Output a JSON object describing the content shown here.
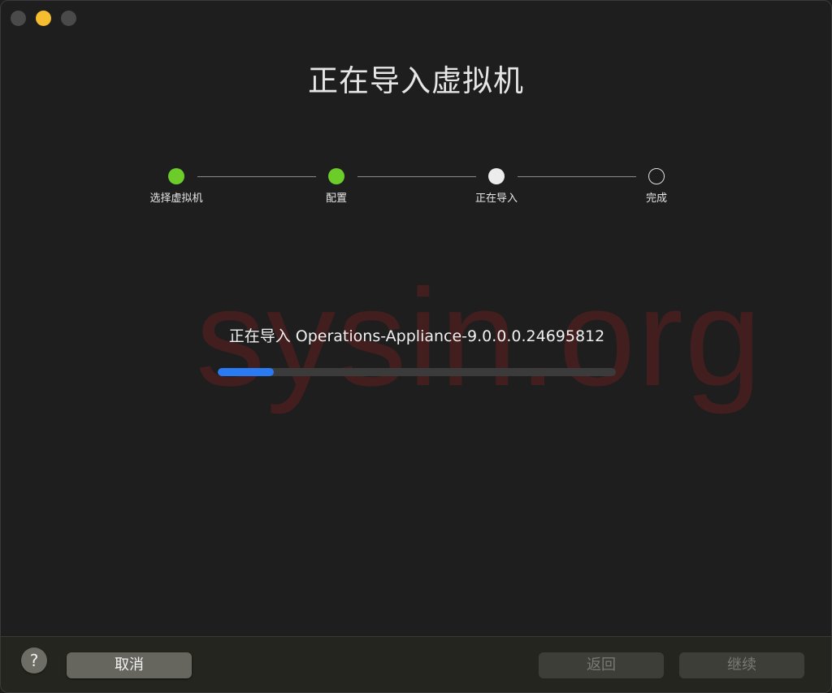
{
  "window": {
    "title": "正在导入虚拟机"
  },
  "steps": [
    {
      "label": "选择虚拟机",
      "status": "done"
    },
    {
      "label": "配置",
      "status": "done"
    },
    {
      "label": "正在导入",
      "status": "current"
    },
    {
      "label": "完成",
      "status": "todo"
    }
  ],
  "import": {
    "label": "正在导入 Operations-Appliance-9.0.0.0.24695812",
    "progress_percent": 14
  },
  "watermark": "sysin.org",
  "footer": {
    "help_label": "?",
    "cancel_label": "取消",
    "back_label": "返回",
    "next_label": "继续"
  },
  "colors": {
    "step_done": "#6ccc2a",
    "progress_fill": "#2a7bf2",
    "minimize": "#f5bd2f"
  }
}
